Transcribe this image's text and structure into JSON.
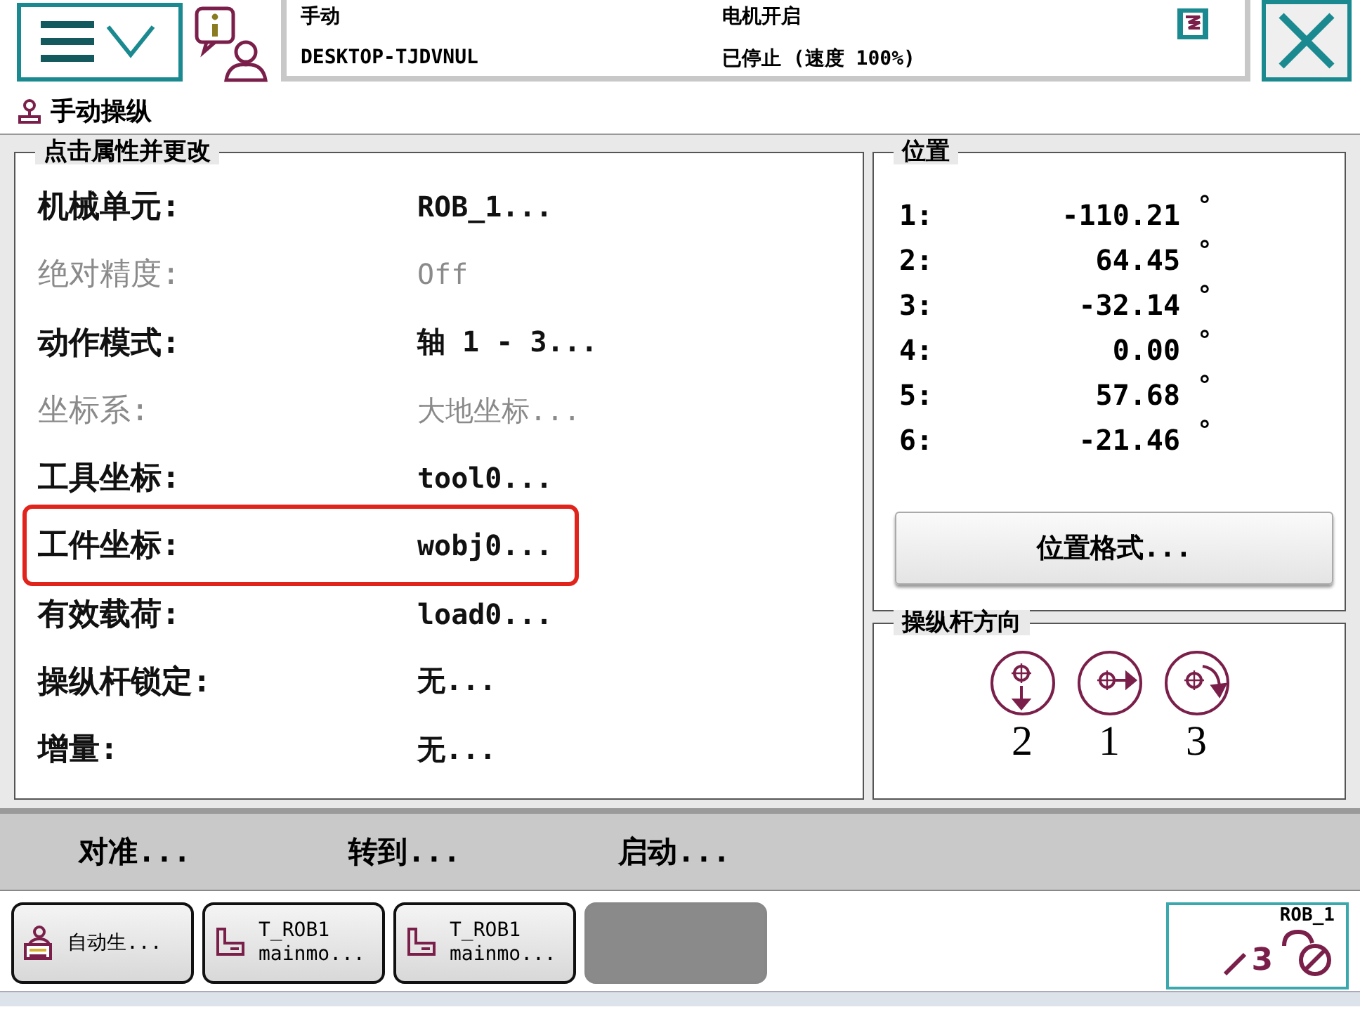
{
  "header": {
    "mode": "手动",
    "system": "DESKTOP-TJDVNUL",
    "motor": "电机开启",
    "state": "已停止 (速度 100%)"
  },
  "title": "手动操纵",
  "properties": {
    "title": "点击属性并更改",
    "items": [
      {
        "label": "机械单元:",
        "value": "ROB_1...",
        "disabled": false,
        "highlighted": false
      },
      {
        "label": "绝对精度:",
        "value": "Off",
        "disabled": true,
        "highlighted": false
      },
      {
        "label": "动作模式:",
        "value": "轴 1 - 3...",
        "disabled": false,
        "highlighted": false
      },
      {
        "label": "坐标系:",
        "value": "大地坐标...",
        "disabled": true,
        "highlighted": false
      },
      {
        "label": "工具坐标:",
        "value": "tool0...",
        "disabled": false,
        "highlighted": false
      },
      {
        "label": "工件坐标:",
        "value": "wobj0...",
        "disabled": false,
        "highlighted": true
      },
      {
        "label": "有效载荷:",
        "value": "load0...",
        "disabled": false,
        "highlighted": false
      },
      {
        "label": "操纵杆锁定:",
        "value": "无...",
        "disabled": false,
        "highlighted": false
      },
      {
        "label": "增量:",
        "value": "无...",
        "disabled": false,
        "highlighted": false
      }
    ]
  },
  "position": {
    "title": "位置",
    "axes": [
      {
        "label": "1:",
        "value": "-110.21",
        "unit": "°"
      },
      {
        "label": "2:",
        "value": "64.45",
        "unit": "°"
      },
      {
        "label": "3:",
        "value": "-32.14",
        "unit": "°"
      },
      {
        "label": "4:",
        "value": "0.00",
        "unit": "°"
      },
      {
        "label": "5:",
        "value": "57.68",
        "unit": "°"
      },
      {
        "label": "6:",
        "value": "-21.46",
        "unit": "°"
      }
    ],
    "button": "位置格式..."
  },
  "joystick": {
    "title": "操纵杆方向",
    "directions": [
      {
        "kind": "down",
        "number": "2"
      },
      {
        "kind": "right",
        "number": "1"
      },
      {
        "kind": "rotate",
        "number": "3"
      }
    ]
  },
  "commands": [
    "对准...",
    "转到...",
    "启动..."
  ],
  "tasks": [
    {
      "kind": "auto",
      "lines": [
        "自动生..."
      ]
    },
    {
      "kind": "program",
      "lines": [
        "T_ROB1",
        "mainmo..."
      ]
    },
    {
      "kind": "program",
      "lines": [
        "T_ROB1",
        "mainmo..."
      ]
    },
    {
      "kind": "empty"
    }
  ],
  "quickset": {
    "unit": "ROB_1",
    "increment": "3"
  }
}
